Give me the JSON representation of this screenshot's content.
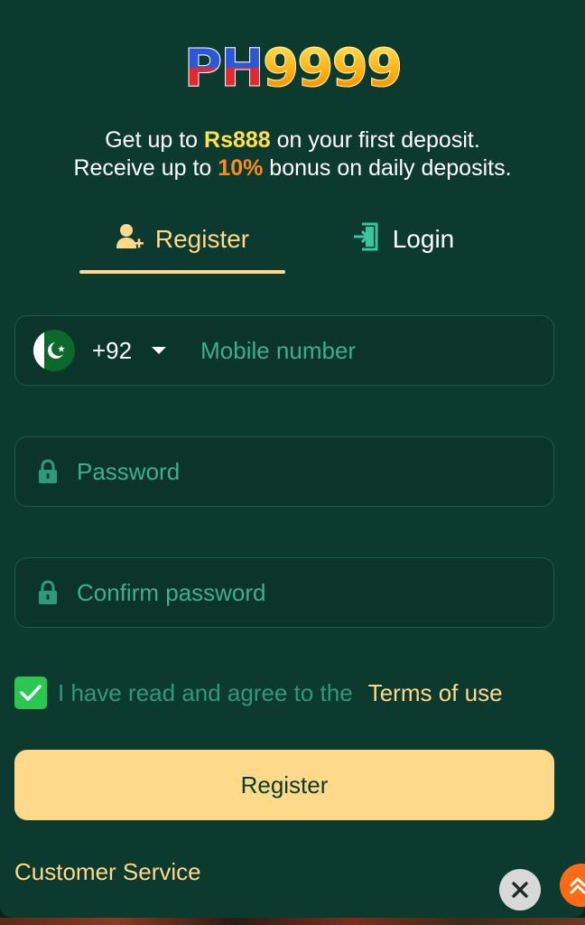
{
  "logo": {
    "part1": "PH",
    "part2": "9999"
  },
  "promo": {
    "line1_prefix": "Get up to ",
    "line1_amount": "Rs888",
    "line1_suffix": " on your first deposit.",
    "line2_prefix": "Receive up to ",
    "line2_percent": "10%",
    "line2_suffix": " bonus on daily deposits."
  },
  "tabs": [
    {
      "label": "Register",
      "icon": "add-user-icon",
      "active": true
    },
    {
      "label": "Login",
      "icon": "login-icon",
      "active": false
    }
  ],
  "form": {
    "country_code": "+92",
    "flag": "pakistan-flag-icon",
    "mobile_placeholder": "Mobile number",
    "password_placeholder": "Password",
    "confirm_placeholder": "Confirm password",
    "agree_text": "I have read and agree to the",
    "terms_link": "Terms of use",
    "agree_checked": true,
    "submit_label": "Register"
  },
  "footer": {
    "customer_service": "Customer Service"
  },
  "colors": {
    "background": "#0c3a2f",
    "accent": "#ffd88a",
    "placeholder": "#3fae8c",
    "checkbox": "#2bc751",
    "highlight_yellow": "#ffe14d",
    "highlight_orange": "#ff8a1e"
  }
}
